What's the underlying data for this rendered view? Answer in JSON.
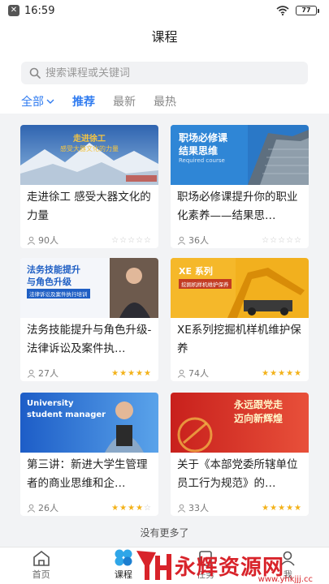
{
  "status": {
    "time": "16:59",
    "battery": "77"
  },
  "header": {
    "title": "课程"
  },
  "search": {
    "placeholder": "搜索课程或关键词"
  },
  "filters": {
    "all_label": "全部",
    "tabs": [
      "推荐",
      "最新",
      "最热"
    ]
  },
  "courses": [
    {
      "title": "走进徐工 感受大器文化的力量",
      "learners": "90人",
      "rating": 0,
      "banner_text": [
        "走进徐工",
        "感受大器文化的力量"
      ]
    },
    {
      "title": "职场必修课提升你的职业化素养——结果思…",
      "learners": "36人",
      "rating": 0,
      "banner_text": [
        "职场必修课",
        "结果思维",
        "Required course"
      ]
    },
    {
      "title": "法务技能提升与角色升级-法律诉讼及案件执…",
      "learners": "27人",
      "rating": 5,
      "banner_text": [
        "法务技能提升",
        "与角色升级",
        "法律诉讼及案件执行培训"
      ]
    },
    {
      "title": "XE系列挖掘机样机维护保养",
      "learners": "74人",
      "rating": 5,
      "banner_text": [
        "XE 系列",
        "挖掘机样机维护保养"
      ]
    },
    {
      "title": "第三讲：新进大学生管理者的商业思维和企…",
      "learners": "26人",
      "rating": 4,
      "banner_text": [
        "University",
        "student manager"
      ]
    },
    {
      "title": "关于《本部党委所辖单位员工行为规范》的…",
      "learners": "33人",
      "rating": 5,
      "banner_text": [
        "永远跟党走",
        "迈向新辉煌"
      ]
    }
  ],
  "footer": {
    "no_more": "没有更多了"
  },
  "tabbar": {
    "items": [
      "首页",
      "课程",
      "任务",
      "我"
    ]
  },
  "overlay_logo": {
    "text": "永辉资源网",
    "url": "www.yhkjjj.cc"
  },
  "colors": {
    "accent": "#2f7bf0",
    "star": "#f3b21a",
    "logo_red": "#d8232a"
  }
}
